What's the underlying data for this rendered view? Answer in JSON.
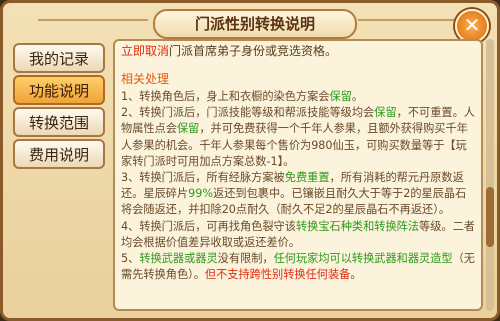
{
  "dialog": {
    "title": "门派性别转换说明",
    "close_label": "✕"
  },
  "tabs": [
    {
      "label": "我的记录",
      "active": false
    },
    {
      "label": "功能说明",
      "active": true
    },
    {
      "label": "转换范围",
      "active": false
    },
    {
      "label": "费用说明",
      "active": false
    }
  ],
  "content": {
    "top_line": {
      "hl": "立即取消",
      "rest": "门派首席弟子身份或竞选资格。"
    },
    "section_title": "相关处理",
    "p1": {
      "a": "1、转换角色后，身上和衣橱的染色方案会",
      "b": "保留",
      "c": "。"
    },
    "p2": {
      "a": "2、转换门派后，门派技能等级和帮派技能等级均会",
      "b": "保留",
      "c": "，不可重置。人物属性点会",
      "d": "保留",
      "e": "，并可免费获得一个千年人参果，且额外获得购买千年人参果的机会。千年人参果每个售价为980仙玉，可购买数量等于【玩家转门派时可用加点方案总数-1】。"
    },
    "p3": {
      "a": "3、转换门派后，所有经脉方案被",
      "b": "免费重置",
      "c": "，所有消耗的帮元丹原数返还。星辰碎片",
      "d": "99%",
      "e": "返还到包裹中。已镶嵌且耐久大于等于2的星辰晶石将会随返还，并扣除20点耐久（耐久不足2的星辰晶石不再返还）。"
    },
    "p4": {
      "a": "4、转换门派后，可再找角色裂守该",
      "b": "转换宝石种类和转换阵法",
      "c": "等级。二者均会根据价值差异收取或返还差价。"
    },
    "p5": {
      "a": "5、",
      "b": "转换武器或器灵",
      "c": "没有限制，",
      "d": "任何玩家均可以转换武器和器灵造型",
      "e": "（无需先转换角色）。",
      "f": "但不支持跨性别转换任何装备",
      "g": "。"
    }
  },
  "scroll": {
    "position_fraction": 0.7
  }
}
